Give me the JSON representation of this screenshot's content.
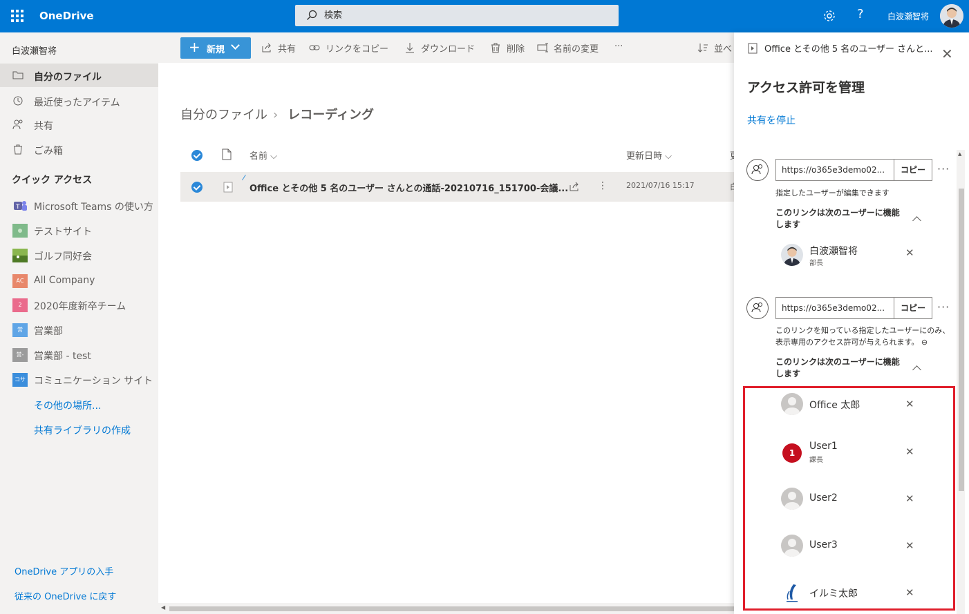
{
  "app": {
    "name": "OneDrive",
    "search_placeholder": "検索",
    "user_name": "白波瀬智将"
  },
  "colors": {
    "accent": "#0078d4",
    "highlight": "#e01e2b",
    "badge": "#c50f1f"
  },
  "leftnav": {
    "owner": "白波瀬智将",
    "items": [
      {
        "label": "自分のファイル",
        "icon": "folder-icon"
      },
      {
        "label": "最近使ったアイテム",
        "icon": "history-icon"
      },
      {
        "label": "共有",
        "icon": "people-icon"
      },
      {
        "label": "ごみ箱",
        "icon": "recycle-bin-icon"
      }
    ],
    "quick_access_title": "クイック アクセス",
    "sites": [
      {
        "label": "Microsoft Teams の使い方",
        "tile": "",
        "color": "#6264a7"
      },
      {
        "label": "テストサイト",
        "tile": "",
        "color": "#7fba8a"
      },
      {
        "label": "ゴルフ同好会",
        "tile": "",
        "color": "#6a9a3a"
      },
      {
        "label": "All Company",
        "tile": "AC",
        "color": "#e8876a"
      },
      {
        "label": "2020年度新卒チーム",
        "tile": "2",
        "color": "#ea6b8c"
      },
      {
        "label": "営業部",
        "tile": "営",
        "color": "#5fa5e6"
      },
      {
        "label": "営業部 - test",
        "tile": "営-",
        "color": "#9b9b9b"
      },
      {
        "label": "コミュニケーション サイト",
        "tile": "コサ",
        "color": "#3b8edc"
      }
    ],
    "more_places": "その他の場所...",
    "create_library": "共有ライブラリの作成",
    "get_app": "OneDrive アプリの入手",
    "classic": "従来の OneDrive に戻す"
  },
  "toolbar": {
    "new": "新規",
    "share": "共有",
    "copy_link": "リンクをコピー",
    "download": "ダウンロード",
    "delete": "削除",
    "rename": "名前の変更",
    "more": "···",
    "sort": "並べ"
  },
  "breadcrumb": {
    "root": "自分のファイル",
    "current": "レコーディング"
  },
  "list": {
    "col_name": "名前",
    "col_modified": "更新日時",
    "col_extra": "更",
    "row": {
      "name": "Office とその他 5 名のユーザー さんとの通話-20210716_151700-会議...",
      "modified": "2021/07/16 15:17",
      "extra": "白"
    }
  },
  "panel": {
    "file_name": "Office とその他 5 名のユーザー さんと...",
    "title": "アクセス許可を管理",
    "stop_sharing": "共有を停止",
    "copy_label": "コピー",
    "links": [
      {
        "url": "https://o365e3demo02...",
        "desc": "指定したユーザーが編集できます",
        "sub": "このリンクは次のユーザーに機能します",
        "people": [
          {
            "name": "白波瀬智将",
            "role": "部長"
          }
        ]
      },
      {
        "url": "https://o365e3demo02...",
        "desc": "このリンクを知っている指定したユーザーにのみ、表示専用のアクセス許可が与えられます。 ⊖",
        "sub": "このリンクは次のユーザーに機能します",
        "people": [
          {
            "name": "Office 太郎",
            "role": ""
          },
          {
            "name": "User1",
            "role": "課長",
            "badge": "1"
          },
          {
            "name": "User2",
            "role": ""
          },
          {
            "name": "User3",
            "role": ""
          },
          {
            "name": "イルミ太郎",
            "role": ""
          }
        ]
      }
    ]
  }
}
